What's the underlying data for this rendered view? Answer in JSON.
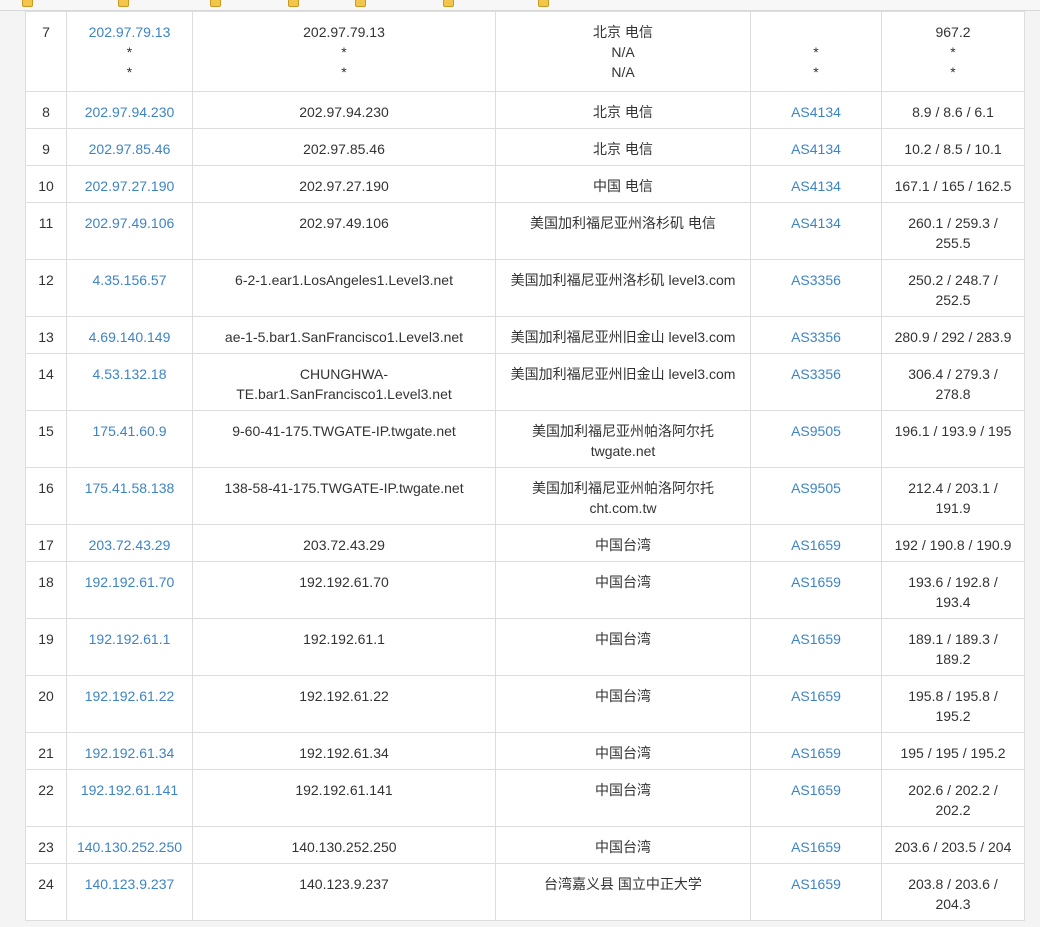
{
  "colors": {
    "link": "#3d84c6",
    "text": "#333333",
    "border": "#dddddd",
    "bookmark": "#f2c64a"
  },
  "rows": [
    {
      "no": "7",
      "ip": [
        "202.97.79.13",
        "*",
        "*"
      ],
      "host": [
        "202.97.79.13",
        "*",
        "*"
      ],
      "loc": [
        "北京 电信",
        "N/A",
        "N/A"
      ],
      "asn": [
        "",
        "*",
        "*"
      ],
      "rtt": [
        "967.2",
        "*",
        "*"
      ]
    },
    {
      "no": "8",
      "ip": [
        "202.97.94.230"
      ],
      "host": [
        "202.97.94.230"
      ],
      "loc": [
        "北京 电信"
      ],
      "asn": [
        "AS4134"
      ],
      "rtt": [
        "8.9 / 8.6 / 6.1"
      ]
    },
    {
      "no": "9",
      "ip": [
        "202.97.85.46"
      ],
      "host": [
        "202.97.85.46"
      ],
      "loc": [
        "北京 电信"
      ],
      "asn": [
        "AS4134"
      ],
      "rtt": [
        "10.2 / 8.5 / 10.1"
      ]
    },
    {
      "no": "10",
      "ip": [
        "202.97.27.190"
      ],
      "host": [
        "202.97.27.190"
      ],
      "loc": [
        "中国 电信"
      ],
      "asn": [
        "AS4134"
      ],
      "rtt": [
        "167.1 / 165 / 162.5"
      ]
    },
    {
      "no": "11",
      "ip": [
        "202.97.49.106"
      ],
      "host": [
        "202.97.49.106"
      ],
      "loc": [
        "美国加利福尼亚州洛杉矶 电信"
      ],
      "asn": [
        "AS4134"
      ],
      "rtt": [
        "260.1 / 259.3 /",
        "255.5"
      ]
    },
    {
      "no": "12",
      "ip": [
        "4.35.156.57"
      ],
      "host": [
        "6-2-1.ear1.LosAngeles1.Level3.net"
      ],
      "loc": [
        "美国加利福尼亚州洛杉矶 level3.com"
      ],
      "asn": [
        "AS3356"
      ],
      "rtt": [
        "250.2 / 248.7 /",
        "252.5"
      ]
    },
    {
      "no": "13",
      "ip": [
        "4.69.140.149"
      ],
      "host": [
        "ae-1-5.bar1.SanFrancisco1.Level3.net"
      ],
      "loc": [
        "美国加利福尼亚州旧金山 level3.com"
      ],
      "asn": [
        "AS3356"
      ],
      "rtt": [
        "280.9 / 292 / 283.9"
      ]
    },
    {
      "no": "14",
      "ip": [
        "4.53.132.18"
      ],
      "host": [
        "CHUNGHWA-",
        "TE.bar1.SanFrancisco1.Level3.net"
      ],
      "loc": [
        "美国加利福尼亚州旧金山 level3.com"
      ],
      "asn": [
        "AS3356"
      ],
      "rtt": [
        "306.4 / 279.3 /",
        "278.8"
      ]
    },
    {
      "no": "15",
      "ip": [
        "175.41.60.9"
      ],
      "host": [
        "9-60-41-175.TWGATE-IP.twgate.net"
      ],
      "loc": [
        "美国加利福尼亚州帕洛阿尔托",
        "twgate.net"
      ],
      "asn": [
        "AS9505"
      ],
      "rtt": [
        "196.1 / 193.9 / 195"
      ]
    },
    {
      "no": "16",
      "ip": [
        "175.41.58.138"
      ],
      "host": [
        "138-58-41-175.TWGATE-IP.twgate.net"
      ],
      "loc": [
        "美国加利福尼亚州帕洛阿尔托",
        "cht.com.tw"
      ],
      "asn": [
        "AS9505"
      ],
      "rtt": [
        "212.4 / 203.1 /",
        "191.9"
      ]
    },
    {
      "no": "17",
      "ip": [
        "203.72.43.29"
      ],
      "host": [
        "203.72.43.29"
      ],
      "loc": [
        "中国台湾"
      ],
      "asn": [
        "AS1659"
      ],
      "rtt": [
        "192 / 190.8 / 190.9"
      ]
    },
    {
      "no": "18",
      "ip": [
        "192.192.61.70"
      ],
      "host": [
        "192.192.61.70"
      ],
      "loc": [
        "中国台湾"
      ],
      "asn": [
        "AS1659"
      ],
      "rtt": [
        "193.6 / 192.8 /",
        "193.4"
      ]
    },
    {
      "no": "19",
      "ip": [
        "192.192.61.1"
      ],
      "host": [
        "192.192.61.1"
      ],
      "loc": [
        "中国台湾"
      ],
      "asn": [
        "AS1659"
      ],
      "rtt": [
        "189.1 / 189.3 /",
        "189.2"
      ]
    },
    {
      "no": "20",
      "ip": [
        "192.192.61.22"
      ],
      "host": [
        "192.192.61.22"
      ],
      "loc": [
        "中国台湾"
      ],
      "asn": [
        "AS1659"
      ],
      "rtt": [
        "195.8 / 195.8 /",
        "195.2"
      ]
    },
    {
      "no": "21",
      "ip": [
        "192.192.61.34"
      ],
      "host": [
        "192.192.61.34"
      ],
      "loc": [
        "中国台湾"
      ],
      "asn": [
        "AS1659"
      ],
      "rtt": [
        "195 / 195 / 195.2"
      ]
    },
    {
      "no": "22",
      "ip": [
        "192.192.61.141"
      ],
      "host": [
        "192.192.61.141"
      ],
      "loc": [
        "中国台湾"
      ],
      "asn": [
        "AS1659"
      ],
      "rtt": [
        "202.6 / 202.2 /",
        "202.2"
      ]
    },
    {
      "no": "23",
      "ip": [
        "140.130.252.250"
      ],
      "host": [
        "140.130.252.250"
      ],
      "loc": [
        "中国台湾"
      ],
      "asn": [
        "AS1659"
      ],
      "rtt": [
        "203.6 / 203.5 / 204"
      ]
    },
    {
      "no": "24",
      "ip": [
        "140.123.9.237"
      ],
      "host": [
        "140.123.9.237"
      ],
      "loc": [
        "台湾嘉义县 国立中正大学"
      ],
      "asn": [
        "AS1659"
      ],
      "rtt": [
        "203.8 / 203.6 /",
        "204.3"
      ]
    }
  ]
}
